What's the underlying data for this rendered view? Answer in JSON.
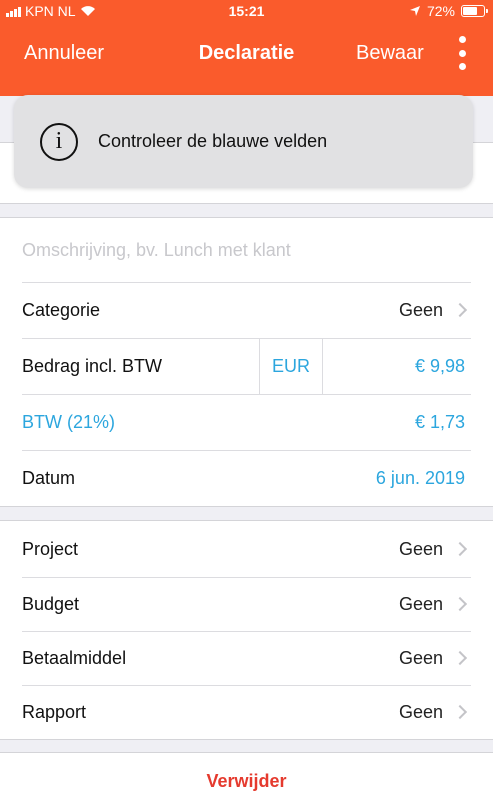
{
  "status_bar": {
    "carrier": "KPN NL",
    "time": "15:21",
    "battery": "72%",
    "battery_level": 0.72
  },
  "nav": {
    "cancel_label": "Annuleer",
    "title": "Declaratie",
    "save_label": "Bewaar"
  },
  "toast": {
    "message": "Controleer de blauwe velden"
  },
  "form": {
    "description_placeholder": "Omschrijving, bv. Lunch met klant",
    "category": {
      "label": "Categorie",
      "value": "Geen"
    },
    "amount": {
      "label": "Bedrag incl. BTW",
      "currency": "EUR",
      "value": "€ 9,98"
    },
    "vat": {
      "label": "BTW (21%)",
      "value": "€ 1,73"
    },
    "date": {
      "label": "Datum",
      "value": "6 jun. 2019"
    }
  },
  "details": [
    {
      "label": "Project",
      "value": "Geen"
    },
    {
      "label": "Budget",
      "value": "Geen"
    },
    {
      "label": "Betaalmiddel",
      "value": "Geen"
    },
    {
      "label": "Rapport",
      "value": "Geen"
    }
  ],
  "delete_label": "Verwijder",
  "colors": {
    "header": "#fa5b2c",
    "accent_blue": "#2ca6de",
    "delete_red": "#e53a2e"
  }
}
